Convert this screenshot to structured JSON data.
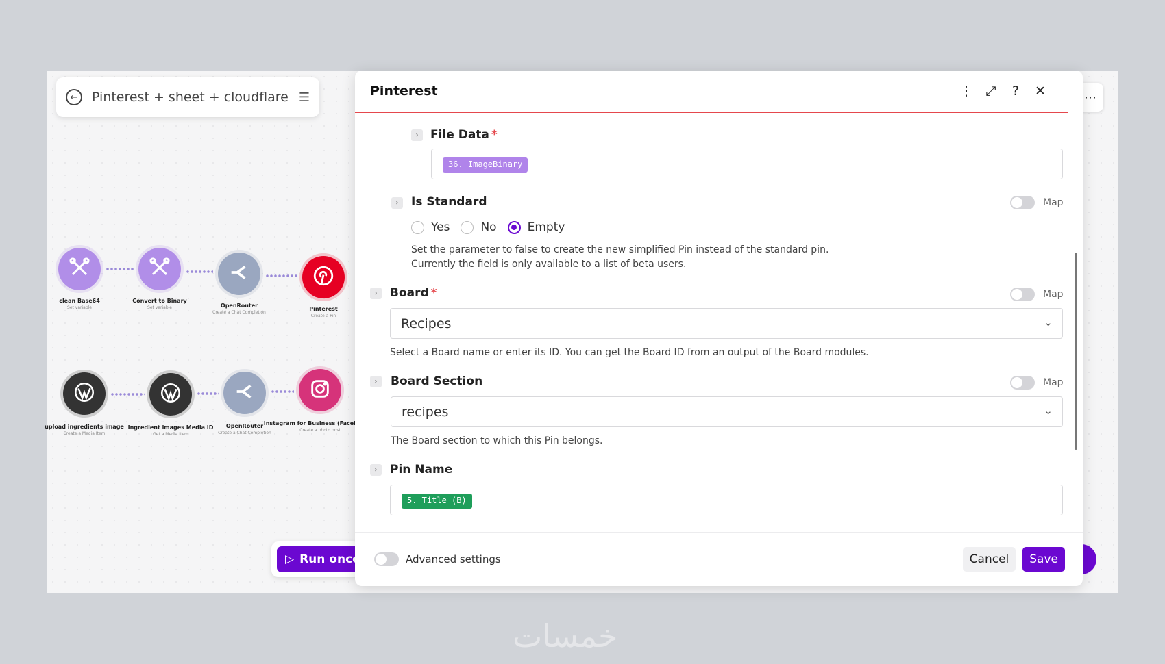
{
  "scenario": {
    "title": "Pinterest + sheet + cloudflare"
  },
  "nodes_row1": [
    {
      "label": "clean Base64",
      "sub": "Set variable",
      "color": "#b18ee8",
      "icon": "tools-icon"
    },
    {
      "label": "Convert to Binary",
      "sub": "Set variable",
      "color": "#b18ee8",
      "icon": "tools-icon"
    },
    {
      "label": "OpenRouter",
      "sub": "Create a Chat Completion",
      "color": "#9aa7c0",
      "icon": "openrouter-icon"
    },
    {
      "label": "Pinterest",
      "sub": "Create a Pin",
      "color": "#e60023",
      "icon": "pinterest-icon"
    }
  ],
  "nodes_row2": [
    {
      "label": "upload ingredients image",
      "sub": "Create a Media Item",
      "color": "#333333",
      "icon": "wordpress-icon"
    },
    {
      "label": "Ingredient images Media ID",
      "sub": "Get a Media Item",
      "color": "#333333",
      "icon": "wordpress-icon"
    },
    {
      "label": "OpenRouter",
      "sub": "Create a Chat Completion",
      "color": "#9aa7c0",
      "icon": "openrouter-icon"
    },
    {
      "label": "Instagram for Business (Facebook lo",
      "sub": "Create a photo post",
      "color": "#d6337a",
      "icon": "instagram-icon"
    }
  ],
  "run_once": {
    "label": "Run once"
  },
  "dialog": {
    "title": "Pinterest",
    "file_data": {
      "label": "File Data",
      "required": "*",
      "token": "36. ImageBinary"
    },
    "is_standard": {
      "label": "Is Standard",
      "map_label": "Map",
      "options": [
        "Yes",
        "No",
        "Empty"
      ],
      "selected": "Empty",
      "help_line1": "Set the parameter to false to create the new simplified Pin instead of the standard pin.",
      "help_line2": "Currently the field is only available to a list of beta users."
    },
    "board": {
      "label": "Board",
      "required": "*",
      "map_label": "Map",
      "value": "Recipes",
      "help": "Select a Board name or enter its ID. You can get the Board ID from an output of the Board modules."
    },
    "board_section": {
      "label": "Board Section",
      "map_label": "Map",
      "value": "recipes",
      "help": "The Board section to which this Pin belongs."
    },
    "pin_name": {
      "label": "Pin Name",
      "token": "5. Title (B)"
    },
    "footer": {
      "advanced_label": "Advanced settings",
      "cancel": "Cancel",
      "save": "Save"
    }
  },
  "colors": {
    "accent": "#6b08d1",
    "error": "#e5484d",
    "token_purple": "#b084ea",
    "token_green": "#1e9e5a"
  },
  "watermark": "خمسات"
}
